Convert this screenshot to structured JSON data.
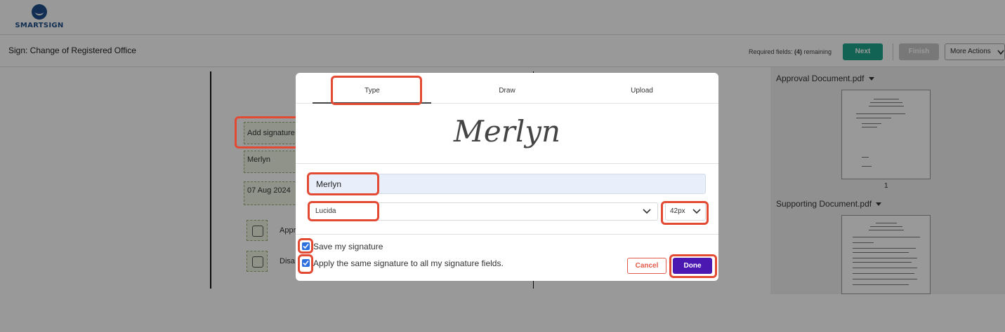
{
  "app": {
    "logo_text": "SMARTSIGN"
  },
  "header": {
    "doc_title": "Sign: Change of Registered Office",
    "required_prefix": "Required fields: ",
    "required_count": "(4)",
    "required_suffix": " remaining",
    "next_label": "Next",
    "finish_label": "Finish",
    "more_actions_label": "More Actions"
  },
  "document": {
    "signature_field_label": "Add signature",
    "name_field_value": "Merlyn",
    "date_field_value": "07 Aug 2024",
    "checkbox_approve_label": "Appr",
    "checkbox_disapprove_label": "Disa"
  },
  "right_panel": {
    "doc1_title": "Approval Document.pdf",
    "doc1_page": "1",
    "doc2_title": "Supporting Document.pdf"
  },
  "modal": {
    "tabs": [
      "Type",
      "Draw",
      "Upload"
    ],
    "active_tab": "Type",
    "preview_text": "Merlyn",
    "name_input_value": "Merlyn",
    "font_value": "Lucida",
    "size_value": "42px",
    "save_signature_label": "Save my signature",
    "save_signature_checked": true,
    "apply_all_label": "Apply the same signature to all my signature fields.",
    "apply_all_checked": true,
    "cancel_label": "Cancel",
    "done_label": "Done"
  },
  "colors": {
    "next_button": "#1ea58a",
    "done_button": "#4b18b2",
    "cancel_button": "#e35a4a",
    "highlight": "#e24a33"
  }
}
